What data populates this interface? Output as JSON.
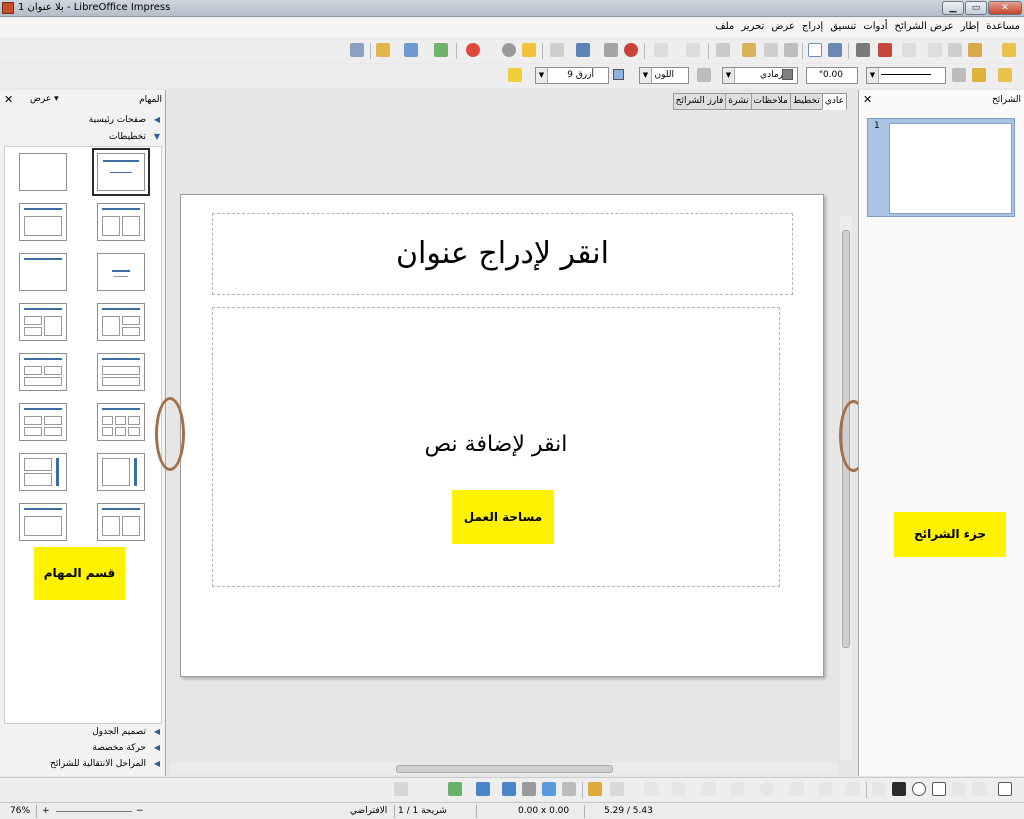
{
  "window": {
    "title": "بلا عنوان 1 - LibreOffice Impress",
    "min": "▁",
    "max": "▭",
    "close": "✕"
  },
  "menu": [
    "ملف",
    "تحرير",
    "عرض",
    "إدراج",
    "تنسيق",
    "أدوات",
    "عرض الشرائح",
    "إطار",
    "مساعدة"
  ],
  "line_toolbar": {
    "line_width": "0.00\"",
    "line_color": "رمادي",
    "fill_type": "اللون",
    "fill_color": "أزرق 9"
  },
  "tasks_pane": {
    "title": "المهام",
    "view_menu": "عرض",
    "close": "✕",
    "sections_top": [
      "صفحات رئيسية",
      "تخطيطات"
    ],
    "sections_bottom": [
      "تصميم الجدول",
      "حركة مخصصة",
      "المراحل الانتقالية للشرائح"
    ]
  },
  "view_tabs": [
    "عادي",
    "تخطيط",
    "ملاحظات",
    "نشرة",
    "فارز الشرائح"
  ],
  "slide": {
    "title_placeholder": "انقر لإدراج عنوان",
    "content_placeholder": "انقر لإضافة نص"
  },
  "callouts": {
    "tasks": "قسم المهام",
    "workspace": "مساحة العمل",
    "slides": "جزء الشرائح"
  },
  "slides_pane": {
    "title": "الشرائح",
    "close": "✕",
    "thumbnail_number": "1"
  },
  "status": {
    "zoom": "76%",
    "slide": "شريحة 1 / 1",
    "layout": "الافتراضي",
    "size": "0.00 x 0.00",
    "position": "5.29 / 5.43"
  },
  "colors": {
    "callout": "#fff200",
    "oval": "#a0714a",
    "thumb_bg": "#a8c4e2",
    "title_rule": "#3b6ea5"
  }
}
